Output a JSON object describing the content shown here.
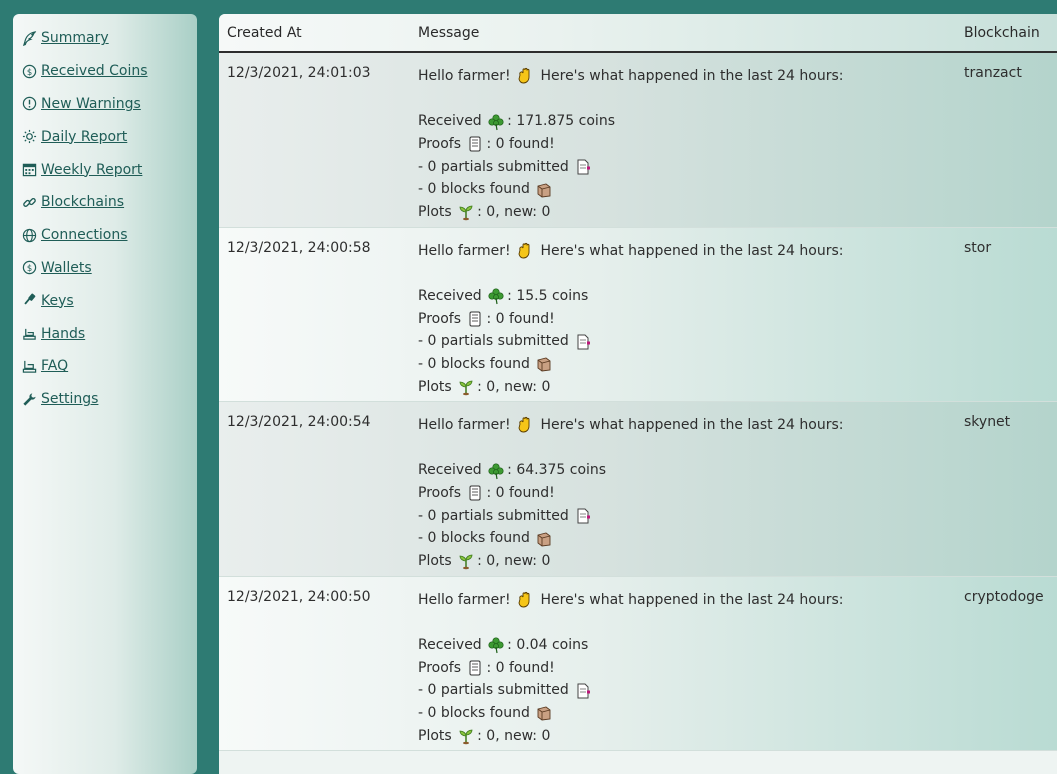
{
  "sidebar": {
    "items": [
      {
        "label": "Summary",
        "icon": "quill-icon"
      },
      {
        "label": "Received Coins",
        "icon": "coin-icon"
      },
      {
        "label": "New Warnings",
        "icon": "warning-icon"
      },
      {
        "label": "Daily Report",
        "icon": "sun-icon"
      },
      {
        "label": "Weekly Report",
        "icon": "calendar-icon"
      },
      {
        "label": "Blockchains",
        "icon": "link-icon"
      },
      {
        "label": "Connections",
        "icon": "globe-icon"
      },
      {
        "label": "Wallets",
        "icon": "wallet-coin-icon"
      },
      {
        "label": "Keys",
        "icon": "key-icon"
      },
      {
        "label": "Hands",
        "icon": "hand-icon"
      },
      {
        "label": "FAQ",
        "icon": "faq-icon"
      },
      {
        "label": "Settings",
        "icon": "wrench-icon"
      }
    ]
  },
  "table": {
    "headers": {
      "created_at": "Created At",
      "message": "Message",
      "blockchain": "Blockchain"
    },
    "rows": [
      {
        "created_at": "12/3/2021, 24:01:03",
        "blockchain": "tranzact",
        "greeting": "Hello farmer!",
        "greeting_tail": "Here's what happened in the last 24 hours:",
        "received_label": "Received",
        "received_value": ": 171.875 coins",
        "proofs_label": "Proofs",
        "proofs_value": ": 0 found!",
        "partials": "- 0 partials submitted",
        "blocks": "- 0 blocks found",
        "plots_label": "Plots",
        "plots_value": ": 0, new: 0"
      },
      {
        "created_at": "12/3/2021, 24:00:58",
        "blockchain": "stor",
        "greeting": "Hello farmer!",
        "greeting_tail": "Here's what happened in the last 24 hours:",
        "received_label": "Received",
        "received_value": ": 15.5 coins",
        "proofs_label": "Proofs",
        "proofs_value": ": 0 found!",
        "partials": "- 0 partials submitted",
        "blocks": "- 0 blocks found",
        "plots_label": "Plots",
        "plots_value": ": 0, new: 0"
      },
      {
        "created_at": "12/3/2021, 24:00:54",
        "blockchain": "skynet",
        "greeting": "Hello farmer!",
        "greeting_tail": "Here's what happened in the last 24 hours:",
        "received_label": "Received",
        "received_value": ": 64.375 coins",
        "proofs_label": "Proofs",
        "proofs_value": ": 0 found!",
        "partials": "- 0 partials submitted",
        "blocks": "- 0 blocks found",
        "plots_label": "Plots",
        "plots_value": ": 0, new: 0"
      },
      {
        "created_at": "12/3/2021, 24:00:50",
        "blockchain": "cryptodoge",
        "greeting": "Hello farmer!",
        "greeting_tail": "Here's what happened in the last 24 hours:",
        "received_label": "Received",
        "received_value": ": 0.04 coins",
        "proofs_label": "Proofs",
        "proofs_value": ": 0 found!",
        "partials": "- 0 partials submitted",
        "blocks": "- 0 blocks found",
        "plots_label": "Plots",
        "plots_value": ": 0, new: 0"
      }
    ]
  },
  "colors": {
    "background": "#2e7b73",
    "link": "#1f5d57",
    "header_rule": "#2d2d2d"
  }
}
